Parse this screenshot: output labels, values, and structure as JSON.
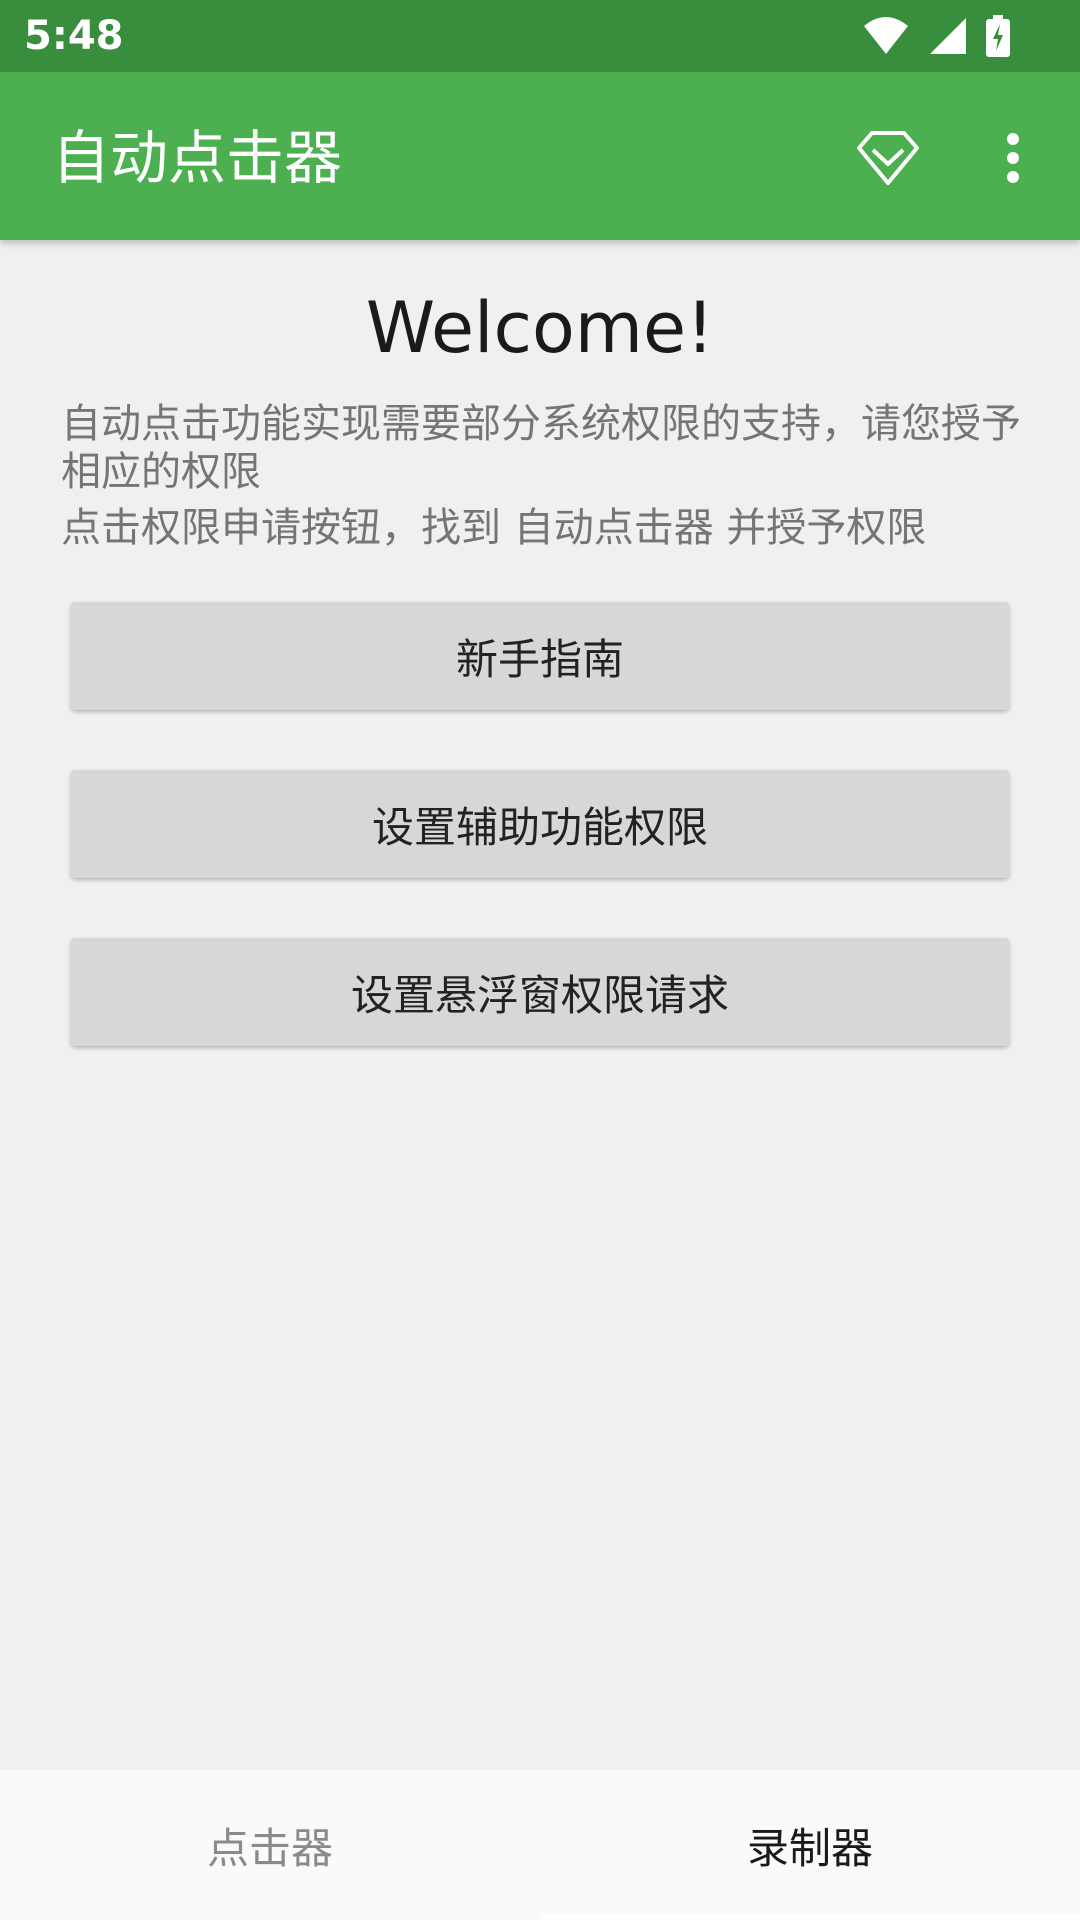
{
  "status_bar": {
    "time": "5:48",
    "icons": [
      "wifi-icon",
      "cell-signal-icon",
      "battery-charging-icon"
    ]
  },
  "app_bar": {
    "title": "自动点击器",
    "actions": [
      "gem-icon",
      "more-vert-icon"
    ]
  },
  "main": {
    "welcome": "Welcome!",
    "intro_line1": "自动点击功能实现需要部分系统权限的支持，请您授予相应的权限",
    "intro_line2": "点击权限申请按钮，找到 自动点击器 并授予权限",
    "buttons": {
      "guide": "新手指南",
      "accessibility": "设置辅助功能权限",
      "overlay": "设置悬浮窗权限请求"
    }
  },
  "bottom_nav": {
    "tabs": [
      {
        "label": "点击器",
        "selected": false
      },
      {
        "label": "录制器",
        "selected": true
      }
    ]
  },
  "colors": {
    "status_bar": "#388e3c",
    "app_bar": "#4caf50",
    "background": "#f0f0f0",
    "button": "#d6d7d7"
  }
}
